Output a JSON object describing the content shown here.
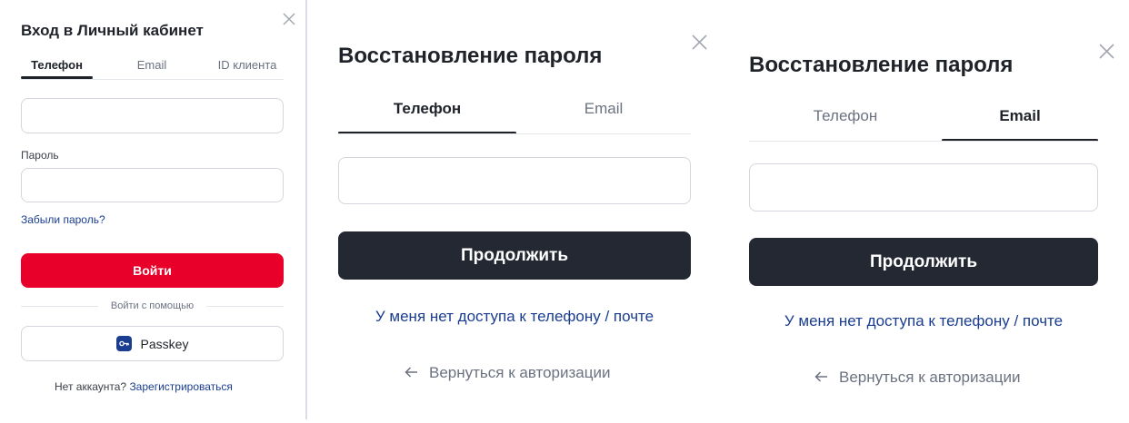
{
  "login": {
    "title": "Вход в Личный кабинет",
    "tabs": [
      {
        "label": "Телефон",
        "active": true
      },
      {
        "label": "Email",
        "active": false
      },
      {
        "label": "ID клиента",
        "active": false
      }
    ],
    "phone_value": "",
    "password_label": "Пароль",
    "password_value": "",
    "forgot_link": "Забыли пароль?",
    "submit_label": "Войти",
    "alt_login_text": "Войти с помощью",
    "passkey_label": "Passkey",
    "no_account_text": "Нет аккаунта?",
    "register_link": "Зарегистрироваться"
  },
  "recovery_phone": {
    "title": "Восстановление пароля",
    "tabs": [
      {
        "label": "Телефон",
        "active": true
      },
      {
        "label": "Email",
        "active": false
      }
    ],
    "input_value": "",
    "continue_label": "Продолжить",
    "no_access_link": "У меня нет доступа к телефону / почте",
    "back_label": "Вернуться к авторизации"
  },
  "recovery_email": {
    "title": "Восстановление пароля",
    "tabs": [
      {
        "label": "Телефон",
        "active": false
      },
      {
        "label": "Email",
        "active": true
      }
    ],
    "input_value": "",
    "continue_label": "Продолжить",
    "no_access_link": "У меня нет доступа к телефону / почте",
    "back_label": "Вернуться к авторизации"
  },
  "colors": {
    "brand_red": "#e8002a",
    "dark_button": "#232833",
    "link_blue": "#1a3d8f"
  },
  "icons": {
    "close": "close-icon",
    "back": "arrow-left-icon",
    "passkey": "passkey-key-icon"
  }
}
